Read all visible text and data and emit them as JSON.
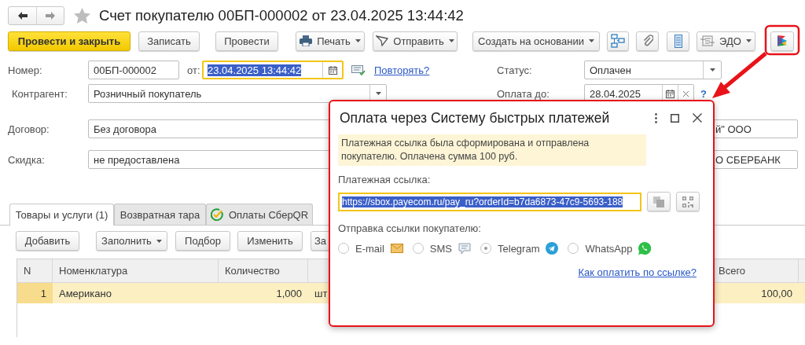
{
  "window": {
    "title": "Счет покупателю 00БП-000002 от 23.04.2025 13:44:42"
  },
  "toolbar": [
    {
      "kind": "primary",
      "label": "Провести и закрыть"
    },
    {
      "kind": "plain",
      "label": "Записать"
    },
    {
      "kind": "plain",
      "label": "Провести"
    },
    {
      "kind": "menu",
      "label": "Печать"
    },
    {
      "kind": "menu",
      "label": "Отправить"
    },
    {
      "kind": "menu",
      "label": "Создать на основании"
    },
    {
      "kind": "icon"
    },
    {
      "kind": "icon"
    },
    {
      "kind": "icon"
    },
    {
      "kind": "menu",
      "label": "ЭДО"
    },
    {
      "kind": "icon"
    }
  ],
  "number": {
    "label": "Номер:",
    "value": "00БП-000002"
  },
  "date": {
    "label": "от:",
    "value": "23.04.2025 13:44:42",
    "focused": true
  },
  "repeat_link": "Повторять?",
  "status": {
    "label": "Статус:",
    "value": "Оплачен"
  },
  "counterparty": {
    "label": "Контрагент:",
    "value": "Розничный покупатель"
  },
  "pay_until": {
    "label": "Оплата до:",
    "value": "28.04.2025",
    "help": "?"
  },
  "contract": {
    "label": "Договор:",
    "value": "Без договора"
  },
  "organization": {
    "value": "й\" ООО"
  },
  "discount": {
    "label": "Скидка:",
    "value": "не предоставлена"
  },
  "bank_account": {
    "value": "О СБЕРБАНК"
  },
  "tabs": [
    {
      "label": "Товары и услуги (1)",
      "selected": true
    },
    {
      "label": "Возвратная тара",
      "selected": false
    },
    {
      "label": "Оплаты СберQR",
      "selected": false
    }
  ],
  "table_toolbar": [
    {
      "kind": "plain",
      "label": "Добавить"
    },
    {
      "kind": "menu",
      "label": "Заполнить"
    },
    {
      "kind": "plain",
      "label": "Подбор"
    },
    {
      "kind": "plain",
      "label": "Изменить"
    },
    {
      "kind": "plain",
      "label": "За"
    }
  ],
  "table": {
    "columns": {
      "n": "N",
      "item": "Номенклатура",
      "quantity": "Количество",
      "total": "Всего"
    },
    "rows": [
      {
        "n": "1",
        "item": "Американо",
        "quantity": "1,000",
        "unit": "шт",
        "total": "100,00",
        "selected": true
      }
    ]
  },
  "dialog": {
    "title": "Оплата через Систему быстрых платежей",
    "message": "Платежная ссылка была сформирована и отправлена покупателю. Оплачена сумма 100 руб.",
    "link_label": "Платежная ссылка:",
    "link_value": "https://sbox.payecom.ru/pay_ru?orderId=b7da6873-47c9-5693-188",
    "send_label": "Отправка ссылки покупателю:",
    "channels": [
      {
        "label": "E-mail",
        "selected": false
      },
      {
        "label": "SMS",
        "selected": false
      },
      {
        "label": "Telegram",
        "selected": true
      },
      {
        "label": "WhatsApp",
        "selected": false
      }
    ],
    "help_link": "Как оплатить по ссылке?"
  }
}
